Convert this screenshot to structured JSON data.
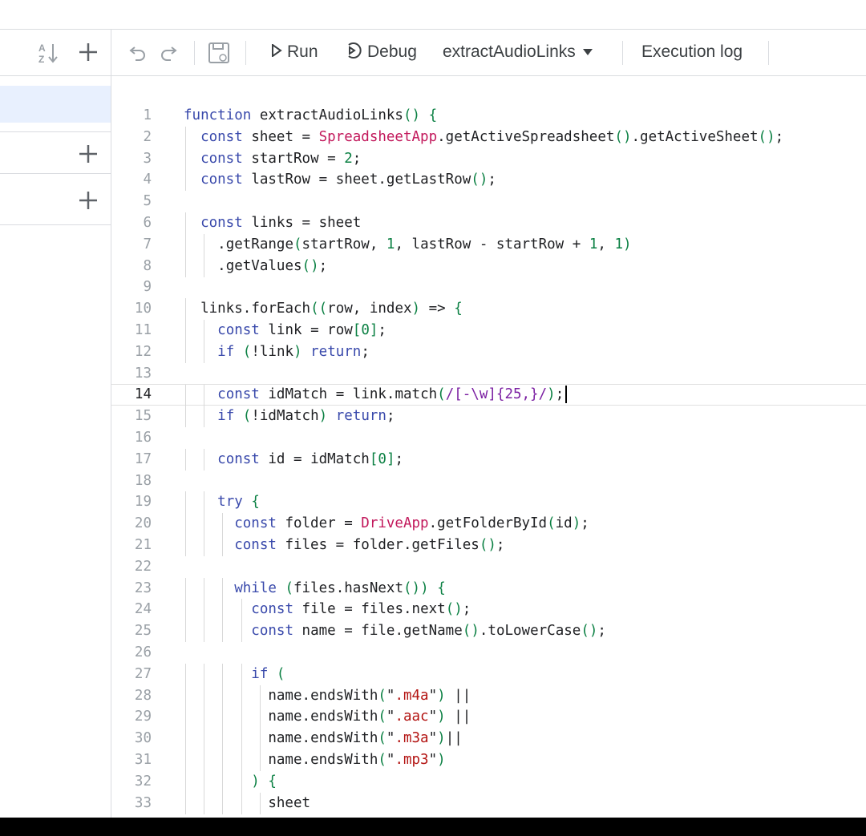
{
  "toolbar": {
    "sort_icon_glyph": "AZ",
    "run_label": "Run",
    "debug_label": "Debug",
    "function_selected": "extractAudioLinks",
    "execution_log_label": "Execution log"
  },
  "icons": [
    "sort-az-icon",
    "add-icon",
    "undo-icon",
    "redo-icon",
    "save-to-drive-icon",
    "play-icon",
    "debug-icon",
    "caret-down-icon"
  ],
  "editor": {
    "active_line": 14,
    "lines": [
      {
        "n": "1",
        "text": "function extractAudioLinks() {"
      },
      {
        "n": "2",
        "text": "  const sheet = SpreadsheetApp.getActiveSpreadsheet().getActiveSheet();"
      },
      {
        "n": "3",
        "text": "  const startRow = 2;"
      },
      {
        "n": "4",
        "text": "  const lastRow = sheet.getLastRow();"
      },
      {
        "n": "5",
        "text": ""
      },
      {
        "n": "6",
        "text": "  const links = sheet"
      },
      {
        "n": "7",
        "text": "    .getRange(startRow, 1, lastRow - startRow + 1, 1)"
      },
      {
        "n": "8",
        "text": "    .getValues();"
      },
      {
        "n": "9",
        "text": ""
      },
      {
        "n": "10",
        "text": "  links.forEach((row, index) => {"
      },
      {
        "n": "11",
        "text": "    const link = row[0];"
      },
      {
        "n": "12",
        "text": "    if (!link) return;"
      },
      {
        "n": "13",
        "text": ""
      },
      {
        "n": "14",
        "text": "    const idMatch = link.match(/[-\\w]{25,}/);"
      },
      {
        "n": "15",
        "text": "    if (!idMatch) return;"
      },
      {
        "n": "16",
        "text": ""
      },
      {
        "n": "17",
        "text": "    const id = idMatch[0];"
      },
      {
        "n": "18",
        "text": ""
      },
      {
        "n": "19",
        "text": "    try {"
      },
      {
        "n": "20",
        "text": "      const folder = DriveApp.getFolderById(id);"
      },
      {
        "n": "21",
        "text": "      const files = folder.getFiles();"
      },
      {
        "n": "22",
        "text": ""
      },
      {
        "n": "23",
        "text": "      while (files.hasNext()) {"
      },
      {
        "n": "24",
        "text": "        const file = files.next();"
      },
      {
        "n": "25",
        "text": "        const name = file.getName().toLowerCase();"
      },
      {
        "n": "26",
        "text": ""
      },
      {
        "n": "27",
        "text": "        if ("
      },
      {
        "n": "28",
        "text": "          name.endsWith(\".m4a\") ||"
      },
      {
        "n": "29",
        "text": "          name.endsWith(\".aac\") ||"
      },
      {
        "n": "30",
        "text": "          name.endsWith(\".m3a\")||"
      },
      {
        "n": "31",
        "text": "          name.endsWith(\".mp3\")"
      },
      {
        "n": "32",
        "text": "        ) {"
      },
      {
        "n": "33",
        "text": "          sheet"
      }
    ]
  }
}
